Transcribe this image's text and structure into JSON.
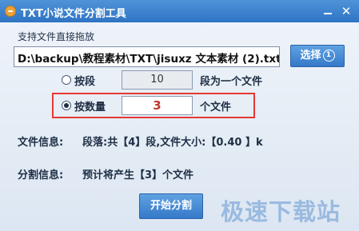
{
  "window": {
    "title": "TXT小说文件分割工具",
    "minimize_glyph": "",
    "close_glyph": "✕"
  },
  "main": {
    "drag_hint": "支持文件直接拖放",
    "file_path": "D:\\backup\\教程素材\\TXT\\jisuxz 文本素材 (2).txt",
    "select_button": {
      "label": "选择",
      "badge": "1"
    },
    "options": [
      {
        "label": "按段",
        "value": "10",
        "suffix": "段为一个文件",
        "selected": false
      },
      {
        "label": "按数量",
        "value": "3",
        "suffix": "个文件",
        "selected": true
      }
    ],
    "file_info": {
      "label": "文件信息:",
      "value": "段落:共【4】段,文件大小:【0.40 】k"
    },
    "split_info": {
      "label": "分割信息:",
      "value": "预计将产生【3】个文件"
    },
    "start_button": "开始分割"
  },
  "watermark": "极速下载站",
  "colors": {
    "titlebar": "#3a7fcc",
    "button": "#3579c9",
    "highlight_border": "#e53935",
    "count_value": "#c0392b"
  }
}
